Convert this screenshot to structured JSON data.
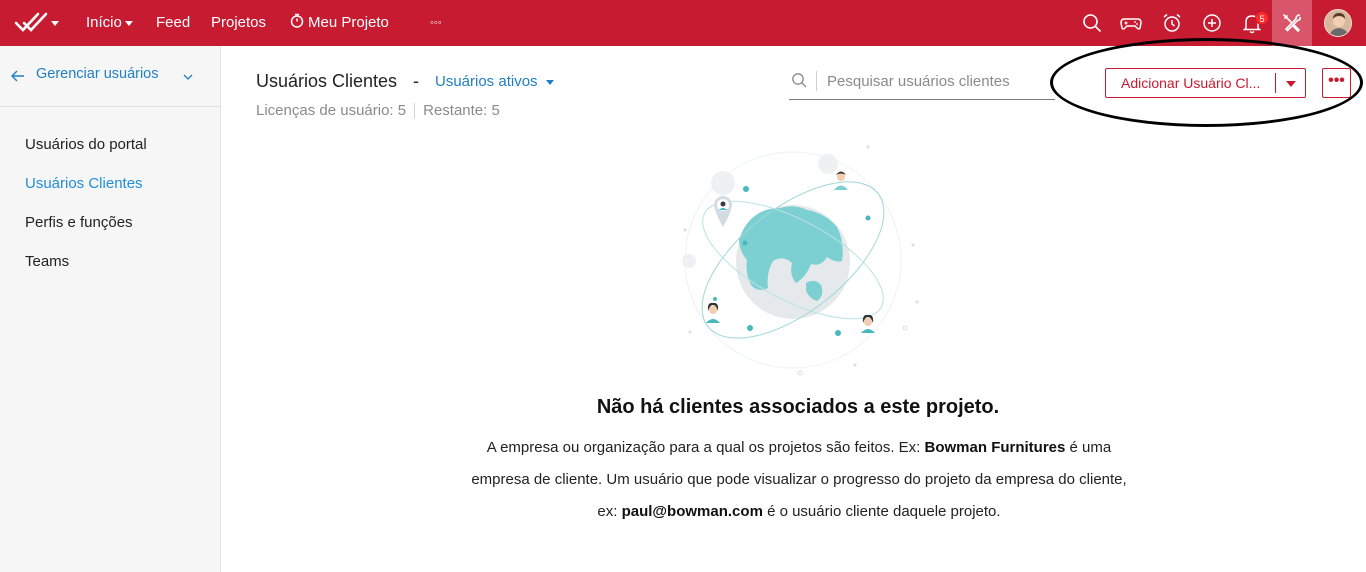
{
  "topbar": {
    "nav": {
      "home": "Início",
      "feed": "Feed",
      "projects": "Projetos",
      "current_project": "Meu Projeto",
      "more": "◦◦◦"
    },
    "notification_count": "5",
    "icons": [
      "app-logo-icon",
      "search-icon",
      "gamepad-icon",
      "alarm-clock-icon",
      "add-circle-icon",
      "bell-icon",
      "tools-icon",
      "user-avatar"
    ],
    "colors": {
      "bar": "#c71b32",
      "active_tool_bg": "#d9556a"
    }
  },
  "sidebar": {
    "header": "Gerenciar usuários",
    "items": [
      {
        "label": "Usuários do portal",
        "active": false
      },
      {
        "label": "Usuários Clientes",
        "active": true
      },
      {
        "label": "Perfis e funções",
        "active": false
      },
      {
        "label": "Teams",
        "active": false
      }
    ]
  },
  "main": {
    "title": "Usuários Clientes",
    "separator": "-",
    "filter": "Usuários ativos",
    "license_label": "Licenças de usuário: 5",
    "remaining_label": "Restante: 5",
    "search_placeholder": "Pesquisar usuários clientes",
    "add_button": "Adicionar Usuário Cl...",
    "more_button": "•••"
  },
  "empty_state": {
    "title": "Não há clientes associados a este projeto.",
    "line1_a": "A empresa ou organização para a qual os projetos são feitos. Ex: ",
    "line1_bold": "Bowman Furnitures",
    "line1_b": " é uma",
    "line2": "empresa de cliente. Um usuário que pode visualizar o progresso do projeto da empresa do cliente,",
    "line3_a": "ex: ",
    "line3_bold": "paul@bowman.com",
    "line3_b": " é o usuário cliente daquele projeto."
  }
}
